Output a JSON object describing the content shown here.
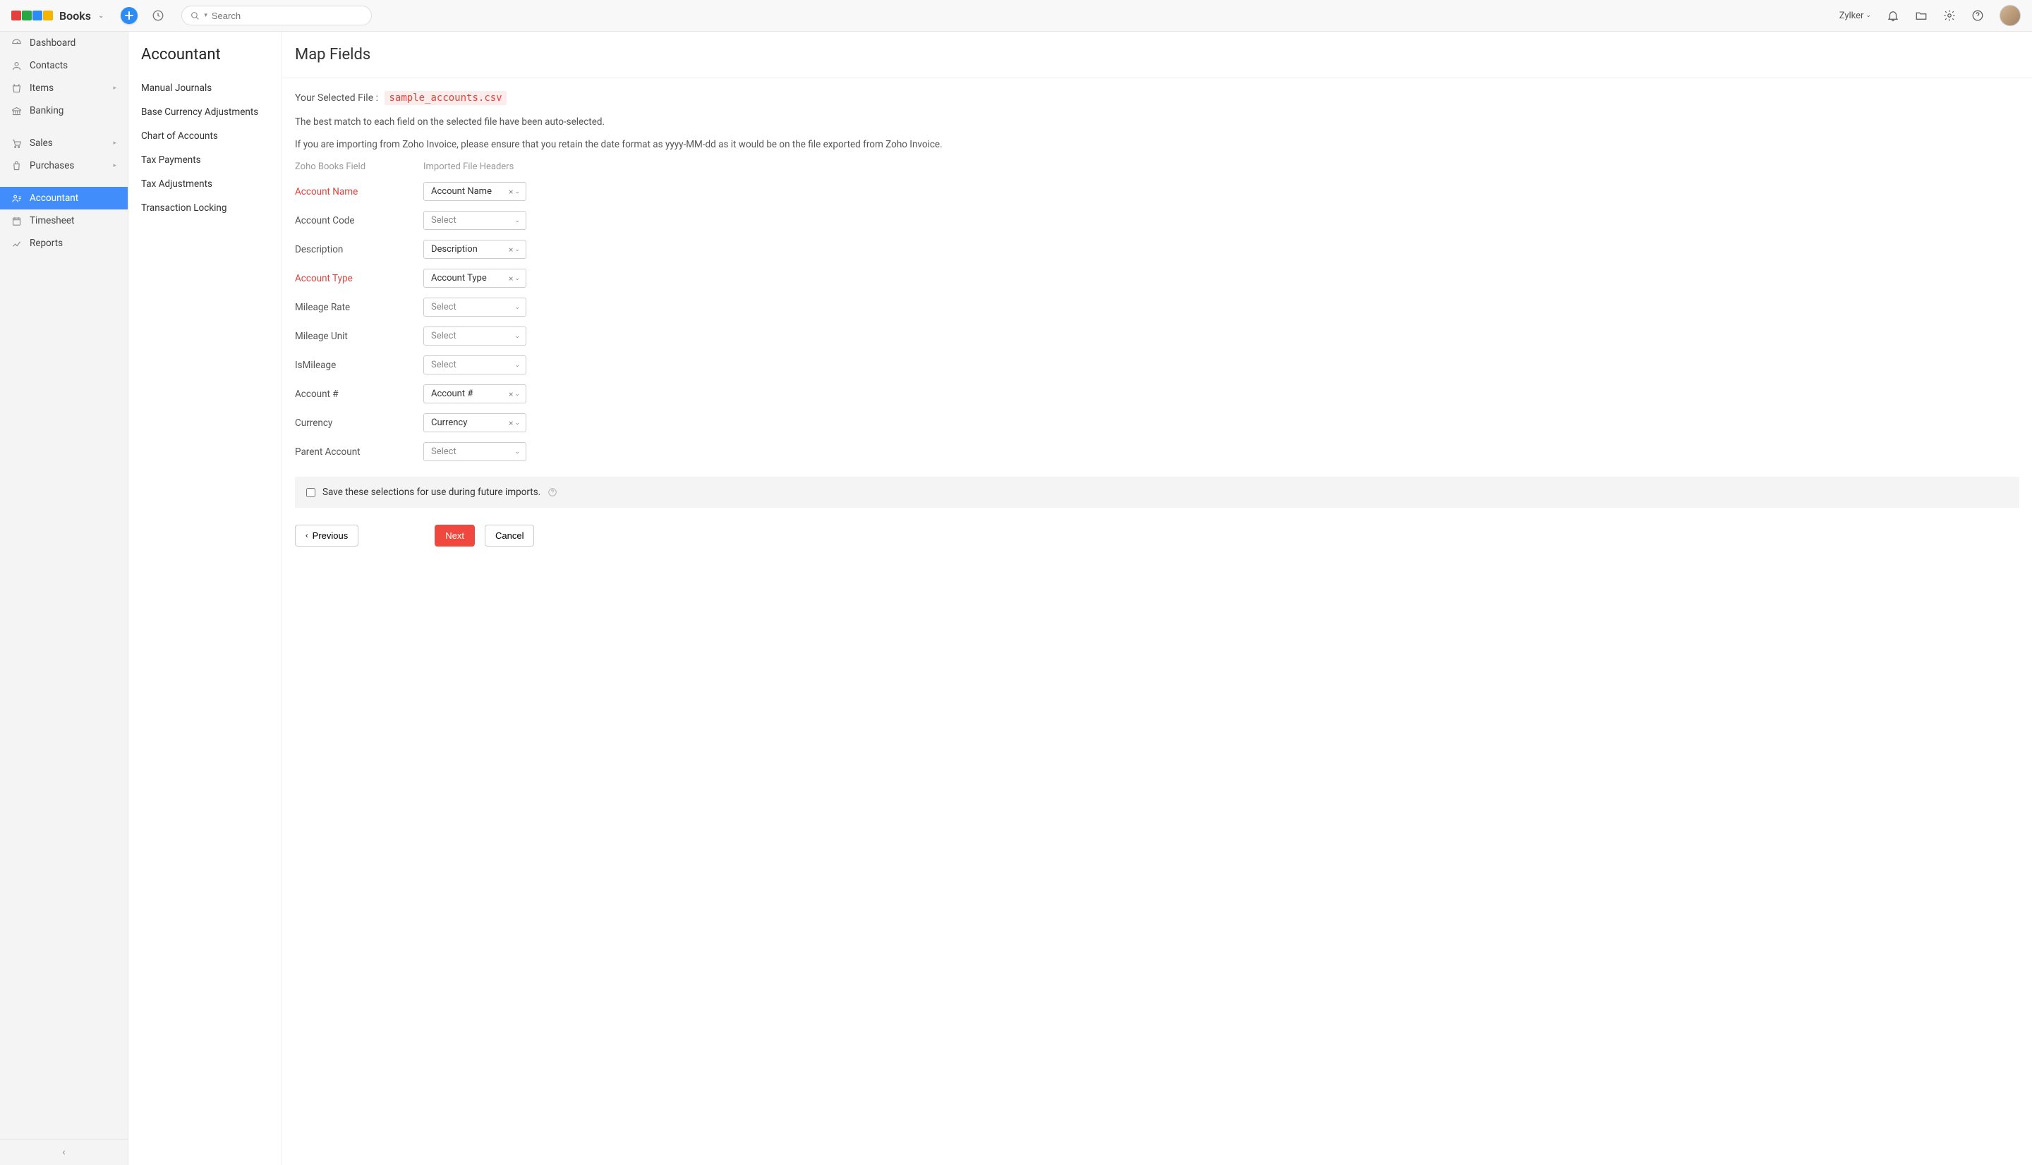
{
  "topbar": {
    "brand": "Books",
    "search_placeholder": "Search",
    "org_name": "Zylker"
  },
  "sidebar": {
    "items": [
      {
        "label": "Dashboard",
        "icon": "dashboard",
        "caret": false
      },
      {
        "label": "Contacts",
        "icon": "contacts",
        "caret": false
      },
      {
        "label": "Items",
        "icon": "items",
        "caret": true
      },
      {
        "label": "Banking",
        "icon": "banking",
        "caret": false
      },
      {
        "label": "Sales",
        "icon": "sales",
        "caret": true
      },
      {
        "label": "Purchases",
        "icon": "purchases",
        "caret": true
      },
      {
        "label": "Accountant",
        "icon": "accountant",
        "caret": false,
        "active": true
      },
      {
        "label": "Timesheet",
        "icon": "timesheet",
        "caret": false
      },
      {
        "label": "Reports",
        "icon": "reports",
        "caret": false
      }
    ]
  },
  "subnav": {
    "title": "Accountant",
    "items": [
      "Manual Journals",
      "Base Currency Adjustments",
      "Chart of Accounts",
      "Tax Payments",
      "Tax Adjustments",
      "Transaction Locking"
    ]
  },
  "main": {
    "title": "Map Fields",
    "selected_file_label": "Your Selected File :",
    "selected_file_name": "sample_accounts.csv",
    "info1": "The best match to each field on the selected file have been auto-selected.",
    "info2": "If you are importing from Zoho Invoice, please ensure that you retain the date format as yyyy-MM-dd as it would be on the file exported from Zoho Invoice.",
    "col1_header": "Zoho Books Field",
    "col2_header": "Imported File Headers",
    "select_placeholder": "Select",
    "fields": [
      {
        "label": "Account Name",
        "required": true,
        "value": "Account Name"
      },
      {
        "label": "Account Code",
        "required": false,
        "value": ""
      },
      {
        "label": "Description",
        "required": false,
        "value": "Description"
      },
      {
        "label": "Account Type",
        "required": true,
        "value": "Account Type"
      },
      {
        "label": "Mileage Rate",
        "required": false,
        "value": ""
      },
      {
        "label": "Mileage Unit",
        "required": false,
        "value": ""
      },
      {
        "label": "IsMileage",
        "required": false,
        "value": ""
      },
      {
        "label": "Account #",
        "required": false,
        "value": "Account #"
      },
      {
        "label": "Currency",
        "required": false,
        "value": "Currency"
      },
      {
        "label": "Parent Account",
        "required": false,
        "value": ""
      }
    ],
    "save_checkbox_label": "Save these selections for use during future imports.",
    "btn_previous": "Previous",
    "btn_next": "Next",
    "btn_cancel": "Cancel"
  }
}
